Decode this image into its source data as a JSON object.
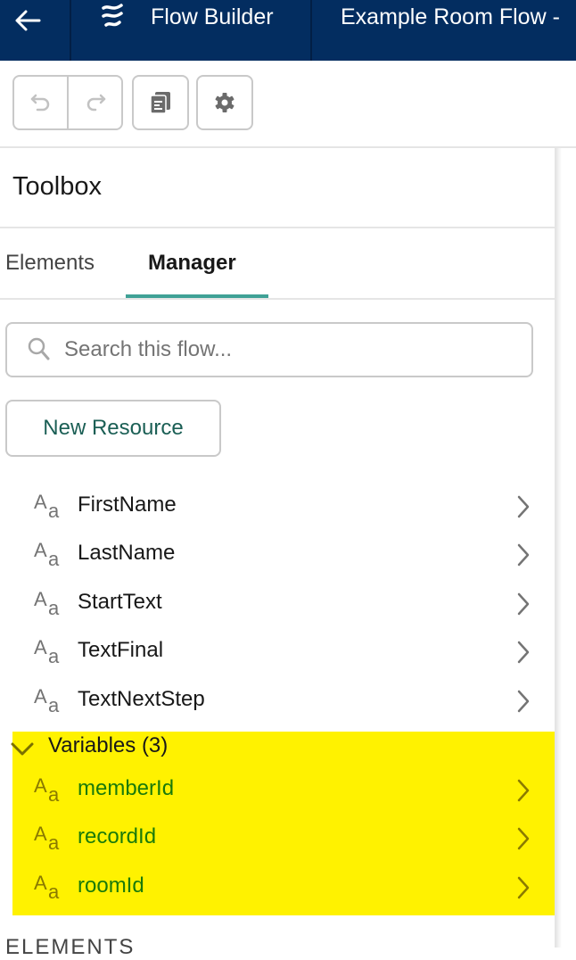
{
  "header": {
    "back_icon": "arrow-left-icon",
    "logo_icon": "flow-logo-icon",
    "app_title": "Flow Builder",
    "flow_name": "Example Room Flow -"
  },
  "toolbar": {
    "undo_icon": "undo-icon",
    "redo_icon": "redo-icon",
    "copy_icon": "copy-icon",
    "settings_icon": "gear-icon"
  },
  "toolbox": {
    "title": "Toolbox",
    "tabs": [
      {
        "label": "Elements",
        "active": false
      },
      {
        "label": "Manager",
        "active": true
      }
    ],
    "search": {
      "placeholder": "Search this flow...",
      "value": ""
    },
    "new_resource_label": "New Resource",
    "resources": [
      {
        "name": "FirstName",
        "icon": "text-type-icon"
      },
      {
        "name": "LastName",
        "icon": "text-type-icon"
      },
      {
        "name": "StartText",
        "icon": "text-type-icon"
      },
      {
        "name": "TextFinal",
        "icon": "text-type-icon"
      },
      {
        "name": "TextNextStep",
        "icon": "text-type-icon"
      }
    ],
    "variables_section": {
      "label": "Variables (3)",
      "expanded": true,
      "items": [
        {
          "name": "memberId",
          "icon": "text-type-icon"
        },
        {
          "name": "recordId",
          "icon": "text-type-icon"
        },
        {
          "name": "roomId",
          "icon": "text-type-icon"
        }
      ]
    },
    "next_section_label": "ELEMENTS"
  },
  "colors": {
    "header_bg": "#032d60",
    "accent_tab": "#3fa196",
    "highlight": "#fff200",
    "highlight_text": "#1a7a0a",
    "button_text": "#1b5f55"
  }
}
